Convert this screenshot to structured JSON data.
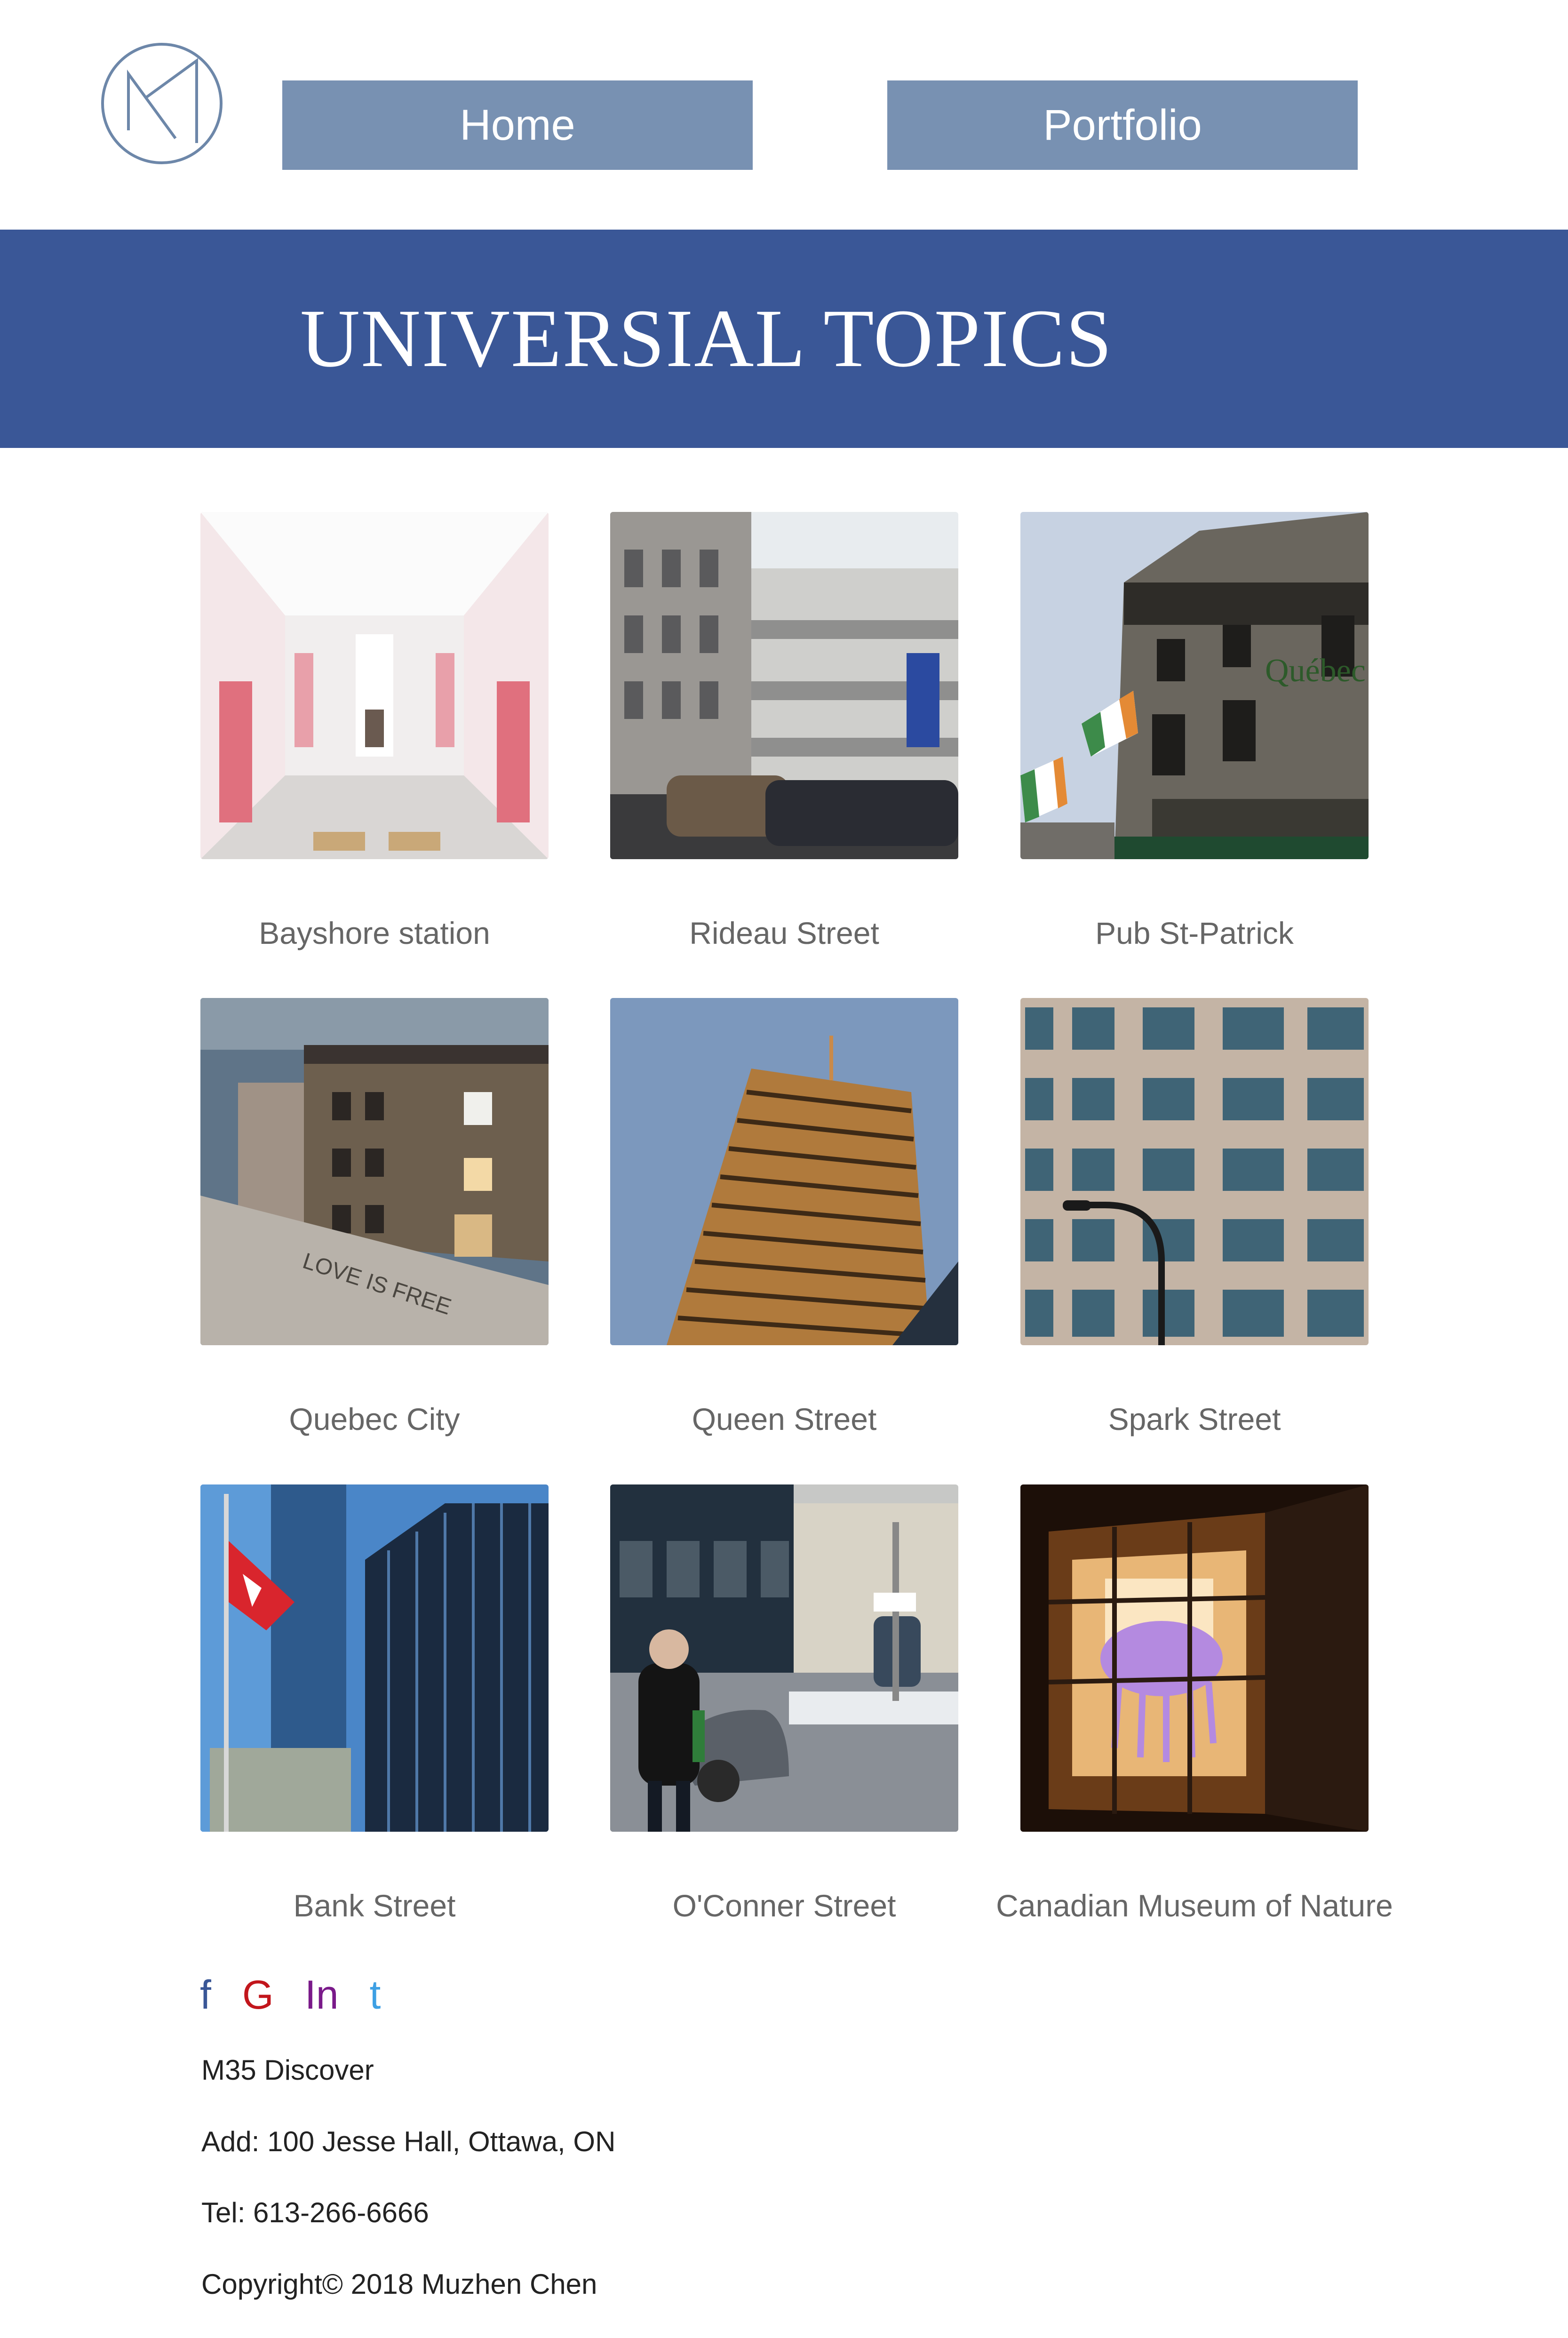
{
  "header": {
    "nav": [
      {
        "label": "Home"
      },
      {
        "label": "Portfolio"
      }
    ]
  },
  "banner": {
    "title": "UNIVERSIAL TOPICS",
    "color": "#3a5797"
  },
  "gallery": [
    {
      "label": "Bayshore station"
    },
    {
      "label": "Rideau Street"
    },
    {
      "label": "Pub St-Patrick"
    },
    {
      "label": "Quebec City"
    },
    {
      "label": "Queen Street"
    },
    {
      "label": "Spark Street"
    },
    {
      "label": "Bank Street"
    },
    {
      "label": "O'Conner Street"
    },
    {
      "label": "Canadian Museum of Nature"
    }
  ],
  "footer": {
    "social": [
      {
        "icon": "facebook-icon",
        "glyph": "f"
      },
      {
        "icon": "google-icon",
        "glyph": "G"
      },
      {
        "icon": "linkedin-icon",
        "glyph": "In"
      },
      {
        "icon": "twitter-icon",
        "glyph": "t"
      }
    ],
    "company": "M35 Discover",
    "address": "Add: 100 Jesse Hall, Ottawa, ON",
    "tel": "Tel: 613-266-6666",
    "copyright": "Copyright© 2018 Muzhen Chen"
  },
  "colors": {
    "nav_button": "#7891b2",
    "banner": "#3a5797",
    "label_text": "#666666"
  }
}
